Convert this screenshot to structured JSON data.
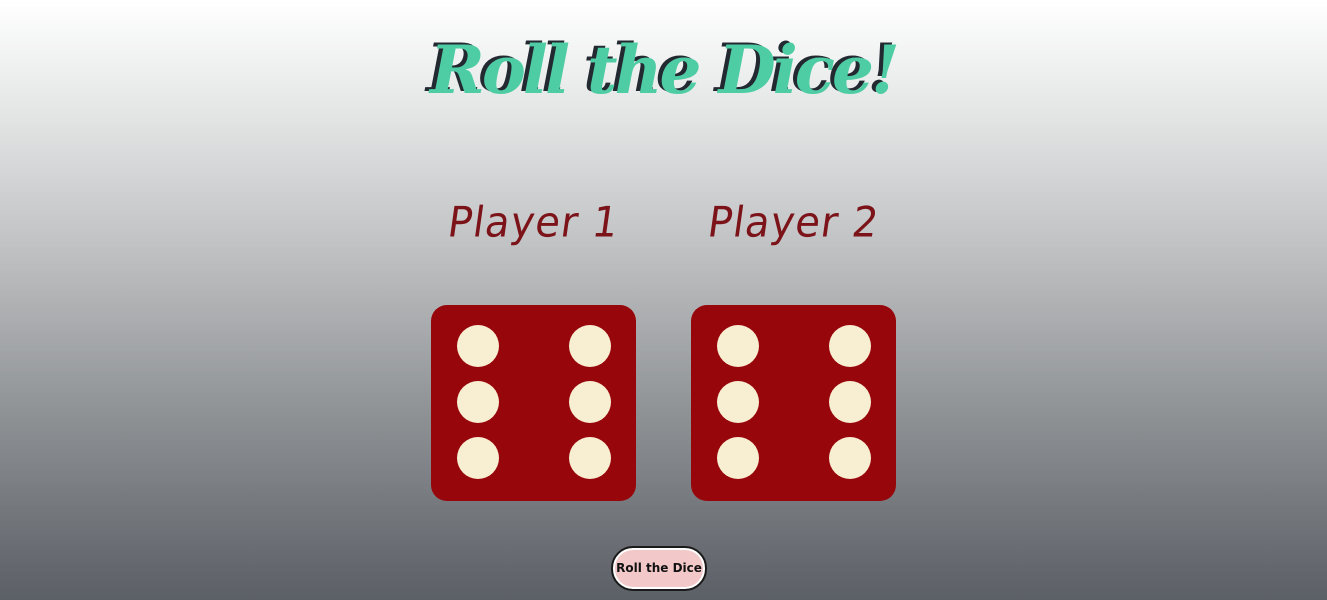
{
  "page": {
    "title": "Roll the Dice!"
  },
  "players": [
    {
      "name": "Player 1",
      "die_value": 6
    },
    {
      "name": "Player 2",
      "die_value": 6
    }
  ],
  "controls": {
    "roll_button_label": "Roll the Dice"
  },
  "colors": {
    "title": "#4ecca3",
    "title_shadow": "#232931",
    "player_name": "#7b1319",
    "die_face": "#97060b",
    "die_pip": "#f8efd3",
    "button_bg": "#f2c9c8"
  },
  "icons": {
    "die_1": "dice-six-icon",
    "die_2": "dice-six-icon"
  }
}
